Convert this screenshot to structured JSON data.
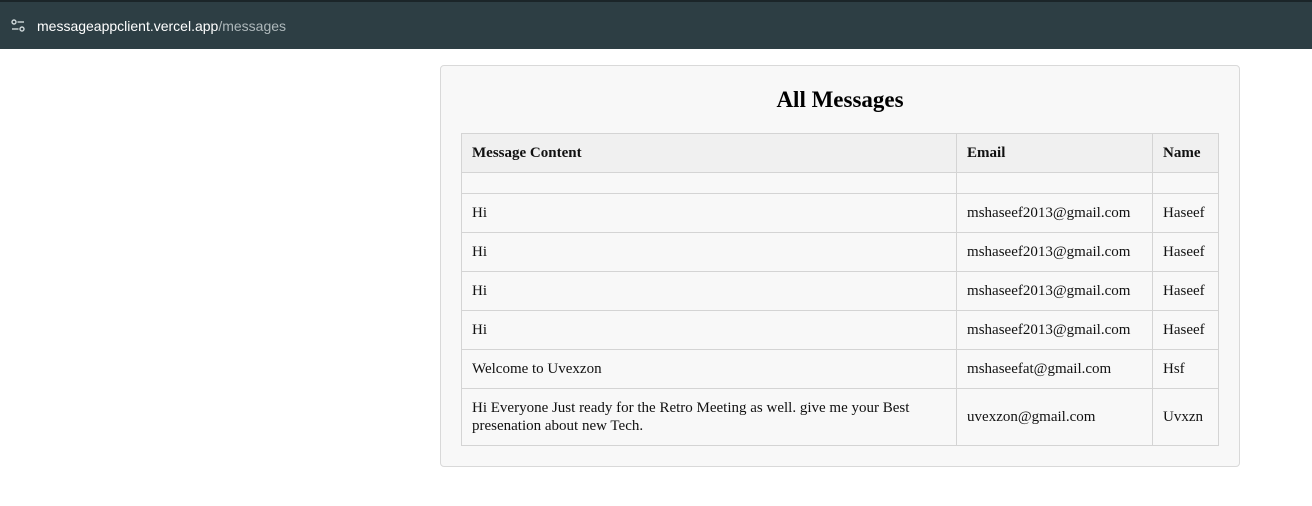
{
  "browser": {
    "url_host": "messageappclient.vercel.app",
    "url_path": "/messages"
  },
  "page": {
    "title": "All Messages"
  },
  "table": {
    "headers": [
      "Message Content",
      "Email",
      "Name"
    ],
    "rows": [
      {
        "content": "",
        "email": "",
        "name": ""
      },
      {
        "content": "Hi",
        "email": "mshaseef2013@gmail.com",
        "name": "Haseef"
      },
      {
        "content": "Hi",
        "email": "mshaseef2013@gmail.com",
        "name": "Haseef"
      },
      {
        "content": "Hi",
        "email": "mshaseef2013@gmail.com",
        "name": "Haseef"
      },
      {
        "content": "Hi",
        "email": "mshaseef2013@gmail.com",
        "name": "Haseef"
      },
      {
        "content": "Welcome to Uvexzon",
        "email": "mshaseefat@gmail.com",
        "name": "Hsf"
      },
      {
        "content": "Hi Everyone Just ready for the Retro Meeting as well. give me your Best presenation about new Tech.",
        "email": "uvexzon@gmail.com",
        "name": "Uvxzn"
      }
    ]
  },
  "icons": {
    "site_info": "tune-icon"
  }
}
